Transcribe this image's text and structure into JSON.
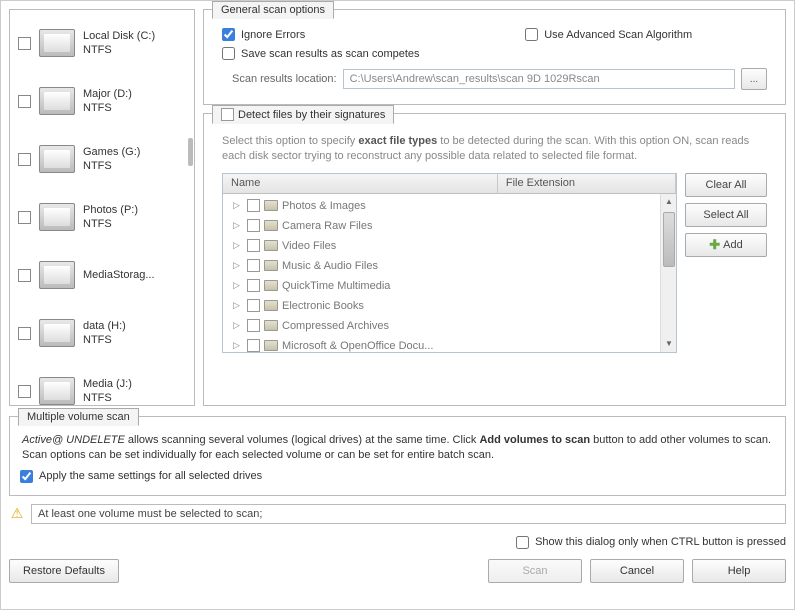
{
  "drives": [
    {
      "name": "Local Disk (C:)",
      "fs": "NTFS"
    },
    {
      "name": "Major (D:)",
      "fs": "NTFS"
    },
    {
      "name": "Games (G:)",
      "fs": "NTFS"
    },
    {
      "name": "Photos (P:)",
      "fs": "NTFS"
    },
    {
      "name": "MediaStorag...",
      "fs": ""
    },
    {
      "name": "data (H:)",
      "fs": "NTFS"
    },
    {
      "name": "Media (J:)",
      "fs": "NTFS"
    }
  ],
  "general": {
    "legend": "General scan options",
    "ignore_errors": "Ignore Errors",
    "use_advanced": "Use Advanced Scan Algorithm",
    "save_results": "Save scan results as scan competes",
    "location_label": "Scan results location:",
    "location_value": "C:\\Users\\Andrew\\scan_results\\scan 9D 1029Rscan",
    "browse_label": "..."
  },
  "signatures": {
    "legend": "Detect files by their signatures",
    "desc_pre": "Select this option to specify ",
    "desc_bold": "exact file types",
    "desc_post": " to be detected during the scan. With this option ON, scan reads each disk sector trying to reconstruct any possible data related to selected file format.",
    "col_name": "Name",
    "col_ext": "File Extension",
    "items": [
      "Photos & Images",
      "Camera Raw Files",
      "Video Files",
      "Music & Audio Files",
      "QuickTime Multimedia",
      "Electronic Books",
      "Compressed Archives",
      "Microsoft & OpenOffice Docu..."
    ],
    "clear_all": "Clear All",
    "select_all": "Select All",
    "add": "Add"
  },
  "multi": {
    "legend": "Multiple volume scan",
    "desc_pre_em": "Active@ UNDELETE",
    "desc_mid": " allows scanning several volumes (logical drives) at the same time. Click ",
    "desc_bold": "Add volumes to scan",
    "desc_post": " button to add other volumes to scan. Scan options can be set individually for each selected volume or can be set for entire batch scan.",
    "apply_same": "Apply the same settings for all selected drives"
  },
  "warning": {
    "text": "At least one volume must be selected to scan;"
  },
  "bottom": {
    "show_only_ctrl": "Show this dialog only when CTRL button is pressed",
    "restore_defaults": "Restore Defaults",
    "scan": "Scan",
    "cancel": "Cancel",
    "help": "Help"
  }
}
